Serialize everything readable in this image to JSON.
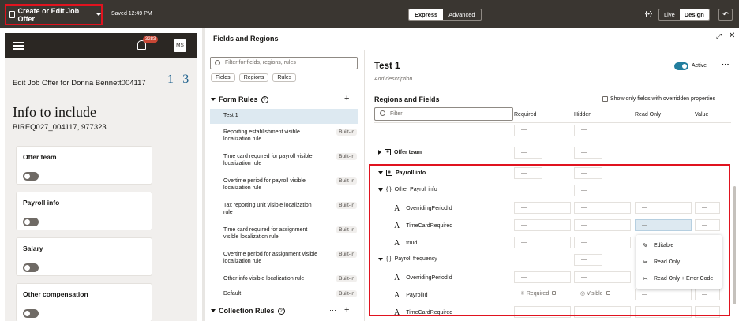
{
  "topbar": {
    "page_name": "Create or Edit Job Offer",
    "saved": "Saved 12:49 PM",
    "modes": [
      "Express",
      "Advanced"
    ],
    "active_mode": "Express",
    "code_icon": "{•}",
    "view_modes": [
      "Live",
      "Design"
    ],
    "active_view": "Design",
    "undo_icon": "↶"
  },
  "preview": {
    "notification_count": "3283",
    "avatar_initials": "MS",
    "edit_title": "Edit Job Offer for Donna Bennett004117",
    "step_current": "1",
    "step_total": "3",
    "section_title": "Info to include",
    "reference": "BIREQ027_004117, 977323",
    "cards": [
      "Offer team",
      "Payroll info",
      "Salary",
      "Other compensation"
    ]
  },
  "panel": {
    "title": "Fields and Regions",
    "search_placeholder": "Filter for fields, regions, rules",
    "chips": [
      "Fields",
      "Regions",
      "Rules"
    ],
    "form_rules_title": "Form Rules",
    "collection_rules_title": "Collection Rules",
    "builtin_label": "Built-in",
    "rules": [
      {
        "name": "Test 1",
        "builtin": false
      },
      {
        "name": "Reporting establishment visible localization rule",
        "builtin": true
      },
      {
        "name": "Time card required for payroll visible localization rule",
        "builtin": true
      },
      {
        "name": "Overtime period for payroll visible localization rule",
        "builtin": true
      },
      {
        "name": "Tax reporting unit visible localization rule",
        "builtin": true
      },
      {
        "name": "Time card required for assignment visible localization rule",
        "builtin": true
      },
      {
        "name": "Overtime period for assignment visible localization rule",
        "builtin": true
      },
      {
        "name": "Other info visible localization rule",
        "builtin": true
      },
      {
        "name": "Default",
        "builtin": true
      }
    ]
  },
  "detail": {
    "rule_title": "Test 1",
    "description_placeholder": "Add description",
    "active_label": "Active",
    "regions_title": "Regions and Fields",
    "show_only_label": "Show only fields with overridden properties",
    "filter_placeholder": "Filter",
    "columns": [
      "Required",
      "Hidden",
      "Read Only",
      "Value"
    ],
    "dash": "—",
    "rows": {
      "offer_team": "Offer team",
      "payroll_info": "Payroll info",
      "other_payroll_info": "Other Payroll info",
      "overriding_period_id": "OverridingPeriodId",
      "time_card_required": "TimeCardRequired",
      "truld": "truId",
      "payroll_frequency": "Payroll frequency",
      "overriding_period_id_2": "OverridingPeriodId",
      "payroll_id": "PayrollId",
      "time_card_required_2": "TimeCardRequired"
    },
    "required_placeholder": "Required",
    "visible_placeholder": "Visible"
  },
  "readonly_menu": {
    "items": [
      {
        "label": "Editable",
        "icon": "pencil-icon"
      },
      {
        "label": "Read Only",
        "icon": "pencil-off-icon"
      },
      {
        "label": "Read Only + Error Code",
        "icon": "pencil-off-icon"
      }
    ]
  }
}
